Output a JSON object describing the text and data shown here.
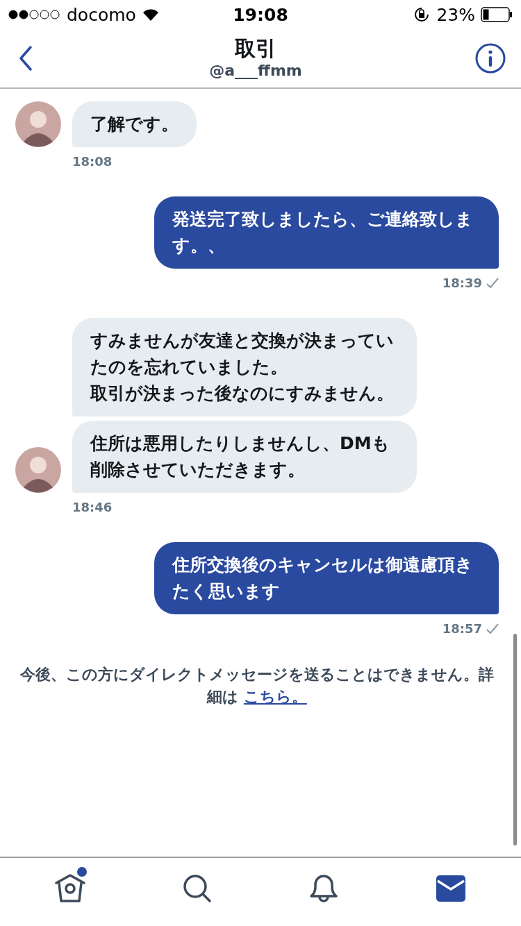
{
  "status_bar": {
    "carrier": "docomo",
    "time": "19:08",
    "battery_percent": "23%"
  },
  "header": {
    "title": "取引",
    "subtitle": "@a___ffmm"
  },
  "messages": [
    {
      "kind": "received",
      "bubbles": [
        "了解です。"
      ],
      "time": "18:08"
    },
    {
      "kind": "sent",
      "bubbles": [
        "発送完了致しましたら、ご連絡致します。、"
      ],
      "time": "18:39",
      "read": true
    },
    {
      "kind": "received",
      "bubbles": [
        [
          "すみませんが友達と交換が決まっていたのを忘れていました。",
          "取引が決まった後なのにすみません。"
        ],
        "住所は悪用したりしませんし、DMも削除させていただきます。"
      ],
      "time": "18:46"
    },
    {
      "kind": "sent",
      "bubbles": [
        "住所交換後のキャンセルは御遠慮頂きたく思います"
      ],
      "time": "18:57",
      "read": true
    }
  ],
  "notice": {
    "text": "今後、この方にダイレクトメッセージを送ることはできません。詳細は ",
    "link": "こちら。"
  },
  "tabs": [
    {
      "kind": "home",
      "selected": false,
      "badge": true
    },
    {
      "kind": "search",
      "selected": false,
      "badge": false
    },
    {
      "kind": "notifications",
      "selected": false,
      "badge": false
    },
    {
      "kind": "messages",
      "selected": true,
      "badge": false
    }
  ]
}
